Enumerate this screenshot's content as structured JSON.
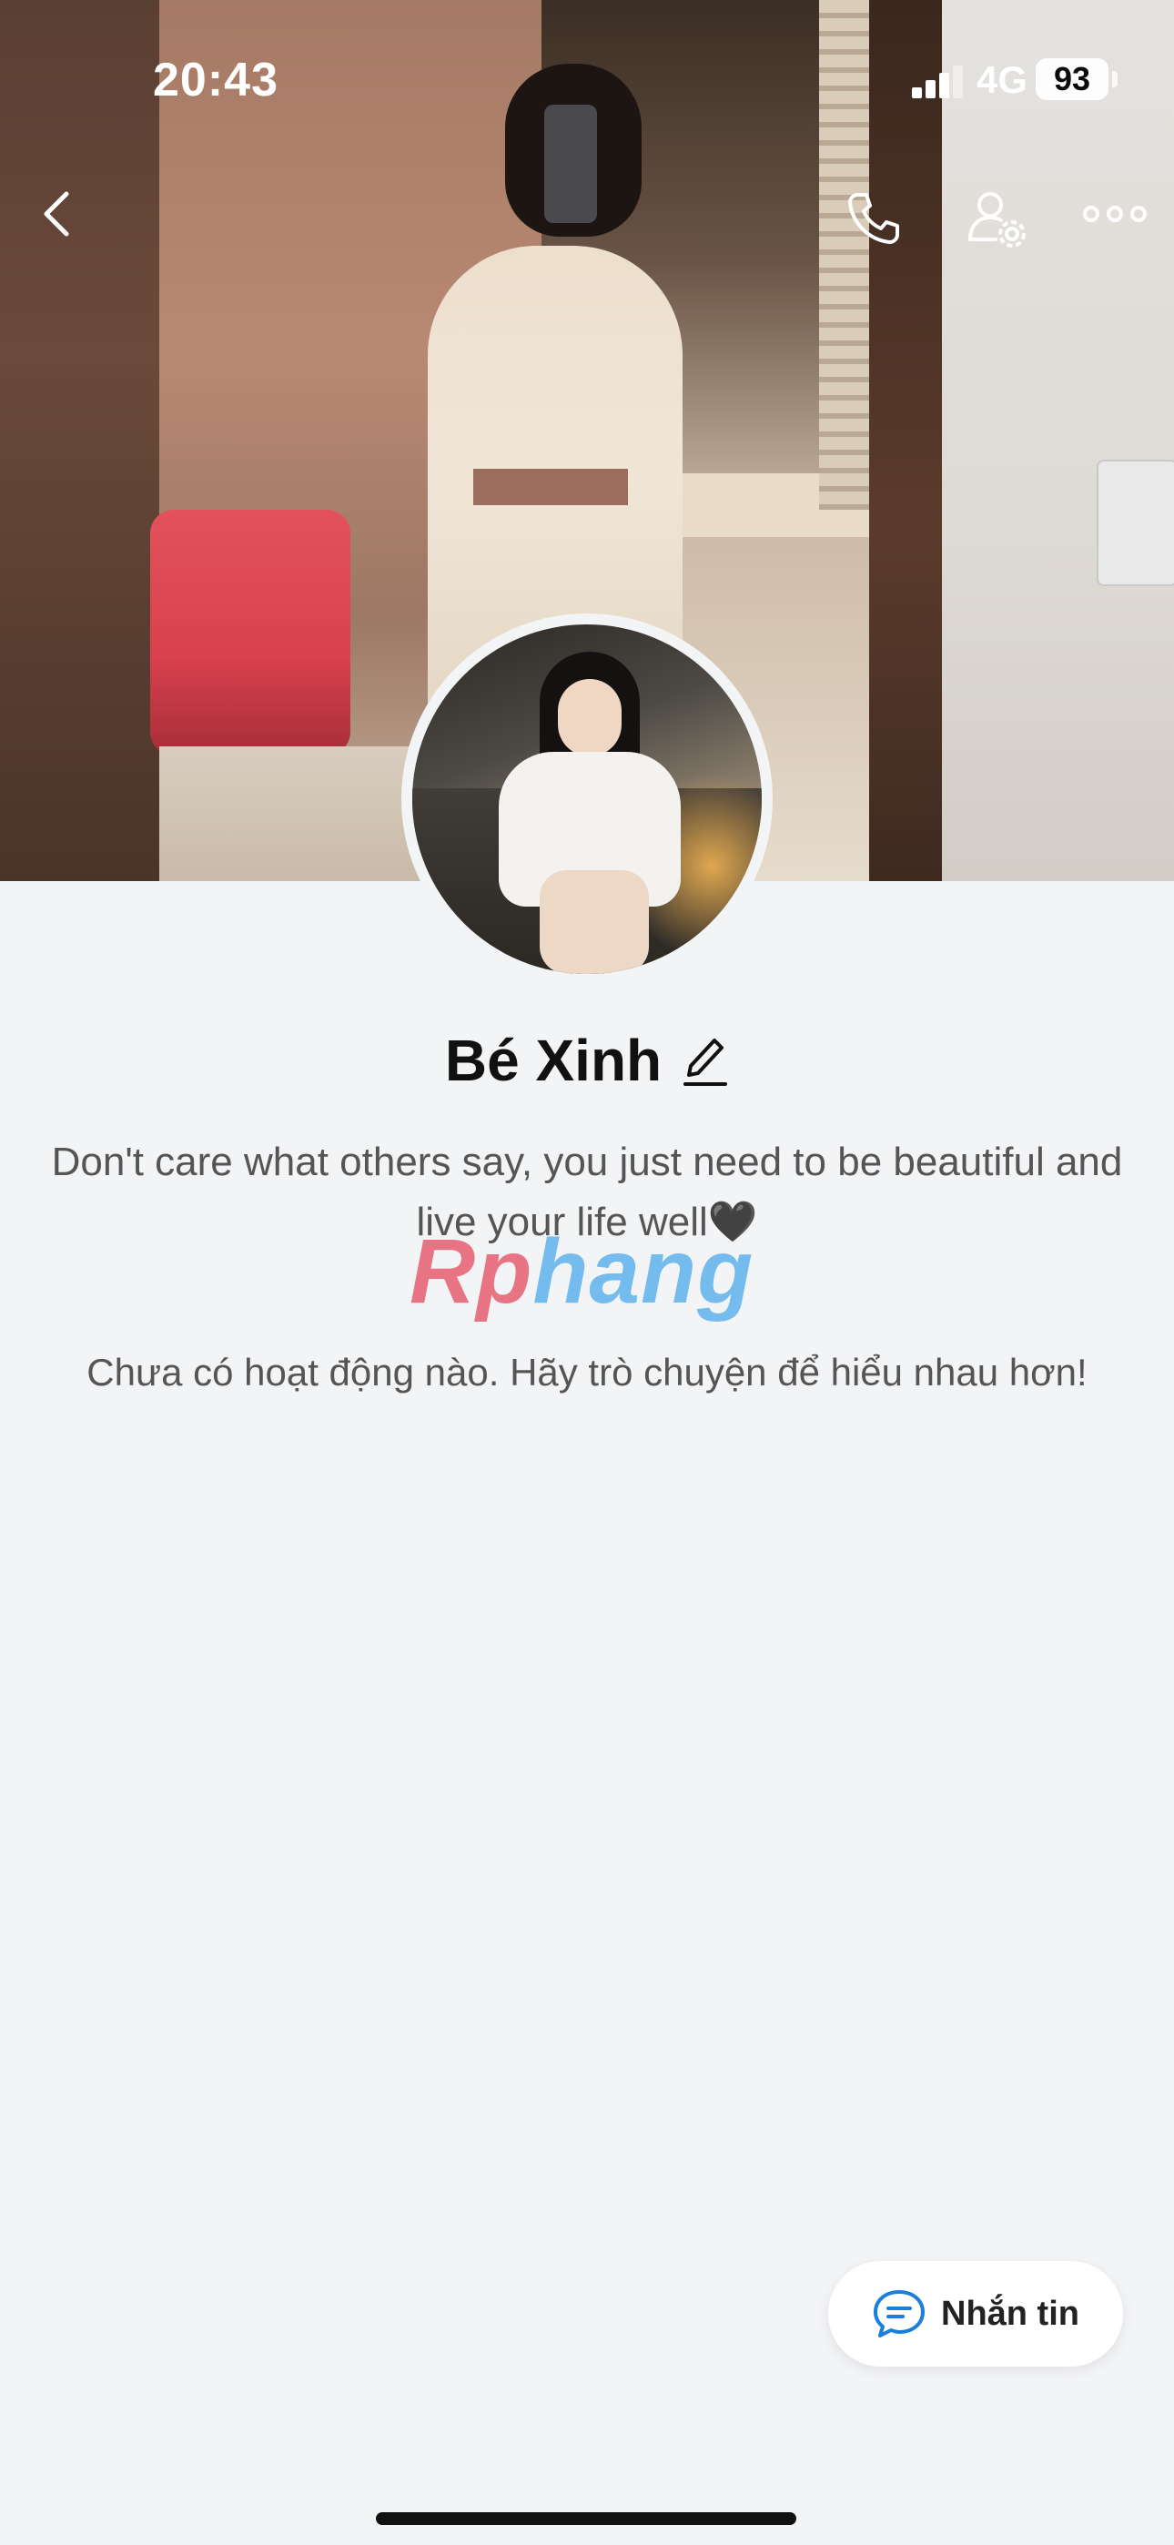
{
  "status_bar": {
    "time": "20:43",
    "network": "4G",
    "battery": "93"
  },
  "header": {
    "icons": [
      "back-icon",
      "phone-icon",
      "user-settings-icon",
      "more-icon"
    ]
  },
  "profile": {
    "name": "Bé Xinh",
    "bio": "Don't care what others say, you just need to be beautiful and live your life well🖤",
    "empty_activity": "Chưa có hoạt động nào. Hãy trò chuyện để hiểu nhau hơn!"
  },
  "watermark": {
    "part1": "Rp",
    "part2": "hang"
  },
  "actions": {
    "message_label": "Nhắn tin"
  },
  "colors": {
    "background": "#f3f4f6",
    "accent": "#1b7fdc"
  }
}
